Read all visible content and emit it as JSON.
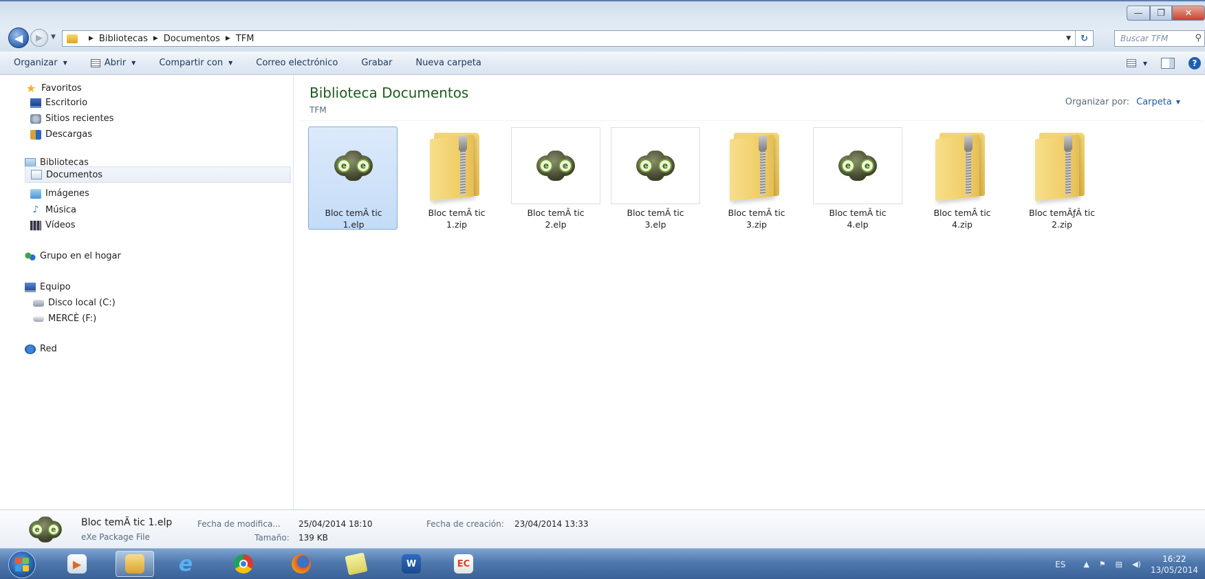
{
  "window": {
    "controls": {
      "minimize": "—",
      "maximize": "❐",
      "close": "✕"
    }
  },
  "navigation": {
    "breadcrumb": [
      "Bibliotecas",
      "Documentos",
      "TFM"
    ],
    "search_placeholder": "Buscar TFM"
  },
  "toolbar": {
    "organize": "Organizar",
    "open": "Abrir",
    "share": "Compartir con",
    "email": "Correo electrónico",
    "burn": "Grabar",
    "new_folder": "Nueva carpeta"
  },
  "sidebar": {
    "favorites": "Favoritos",
    "desktop": "Escritorio",
    "recent": "Sitios recientes",
    "downloads": "Descargas",
    "libraries": "Bibliotecas",
    "documents": "Documentos",
    "images": "Imágenes",
    "music": "Música",
    "videos": "Vídeos",
    "homegroup": "Grupo en el hogar",
    "computer": "Equipo",
    "disk_c": "Disco local (C:)",
    "disk_f": "MERCÈ (F:)",
    "network": "Red",
    "selected": "documents"
  },
  "content": {
    "title": "Biblioteca Documentos",
    "subtitle": "TFM",
    "arrange_label": "Organizar por:",
    "arrange_value": "Carpeta",
    "files": [
      {
        "line1": "Bloc temÃ tic",
        "line2": "1.elp",
        "kind": "elp",
        "selected": true
      },
      {
        "line1": "Bloc temÃ tic",
        "line2": "1.zip",
        "kind": "zip",
        "selected": false
      },
      {
        "line1": "Bloc temÃ tic",
        "line2": "2.elp",
        "kind": "elp",
        "selected": false
      },
      {
        "line1": "Bloc temÃ tic",
        "line2": "3.elp",
        "kind": "elp",
        "selected": false
      },
      {
        "line1": "Bloc temÃ tic",
        "line2": "3.zip",
        "kind": "zip",
        "selected": false
      },
      {
        "line1": "Bloc temÃ tic",
        "line2": "4.elp",
        "kind": "elp",
        "selected": false
      },
      {
        "line1": "Bloc temÃ tic",
        "line2": "4.zip",
        "kind": "zip",
        "selected": false
      },
      {
        "line1": "Bloc temÃƒÂ tic",
        "line2": "2.zip",
        "kind": "zip",
        "selected": false
      }
    ]
  },
  "details": {
    "name": "Bloc temÃ tic 1.elp",
    "type": "eXe Package File",
    "modified_label": "Fecha de modifica...",
    "modified_value": "25/04/2014 18:10",
    "size_label": "Tamaño:",
    "size_value": "139 KB",
    "created_label": "Fecha de creación:",
    "created_value": "23/04/2014 13:33"
  },
  "taskbar": {
    "apps": [
      "media-player",
      "file-explorer",
      "internet-explorer",
      "chrome",
      "firefox",
      "sticky-notes",
      "word",
      "exe-learning"
    ],
    "active_app": "file-explorer",
    "language": "ES",
    "time": "16:22",
    "date": "13/05/2014"
  }
}
